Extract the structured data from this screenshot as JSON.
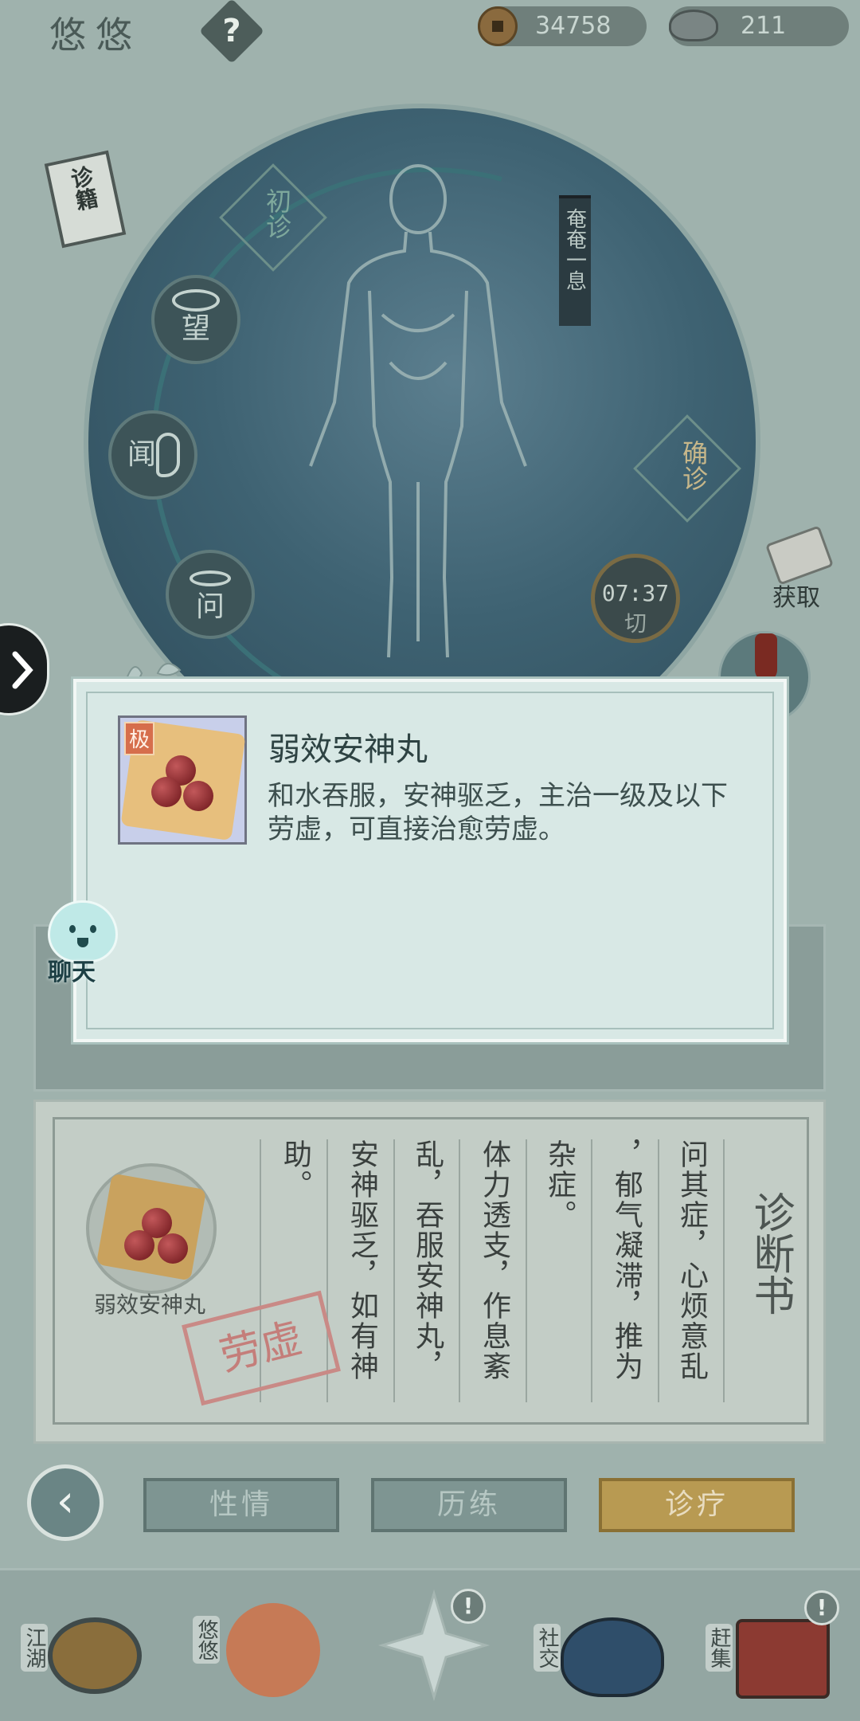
{
  "header": {
    "title": "悠悠",
    "help_label": "?",
    "coins": "34758",
    "ingots": "211"
  },
  "diagnosis": {
    "book_label": "诊籍",
    "first_visit": "初诊",
    "look": "望",
    "listen": "闻",
    "ask": "问",
    "confirm": "确诊",
    "breath_label": "奄奄一息",
    "timer": "07:37",
    "pulse": "切",
    "get_label": "获取"
  },
  "popup": {
    "badge": "极",
    "item_name": "弱效安神丸",
    "item_desc": "和水吞服，安神驱乏，主治一级及以下劳虚，可直接治愈劳虚。"
  },
  "chat": {
    "label": "聊天"
  },
  "report": {
    "title": "诊断书",
    "columns": [
      "问其症，心烦意乱",
      "，郁气凝滞，推为",
      "杂症。",
      "体力透支，作息紊",
      "乱，吞服安神丸，",
      "安神驱乏，如有神",
      "助。"
    ],
    "medicine_label": "弱效安神丸",
    "stamp": "劳虚"
  },
  "tabs": {
    "back": "‹",
    "temperament": "性情",
    "training": "历练",
    "treatment": "诊疗"
  },
  "nav": {
    "jianghu": "江湖",
    "youyou": "悠悠",
    "social": "社交",
    "market": "赶集",
    "alert": "!"
  },
  "colors": {
    "accent_gold": "#b89a52",
    "panel_teal": "#d8e8e5",
    "stamp_red": "#c47e7a"
  }
}
